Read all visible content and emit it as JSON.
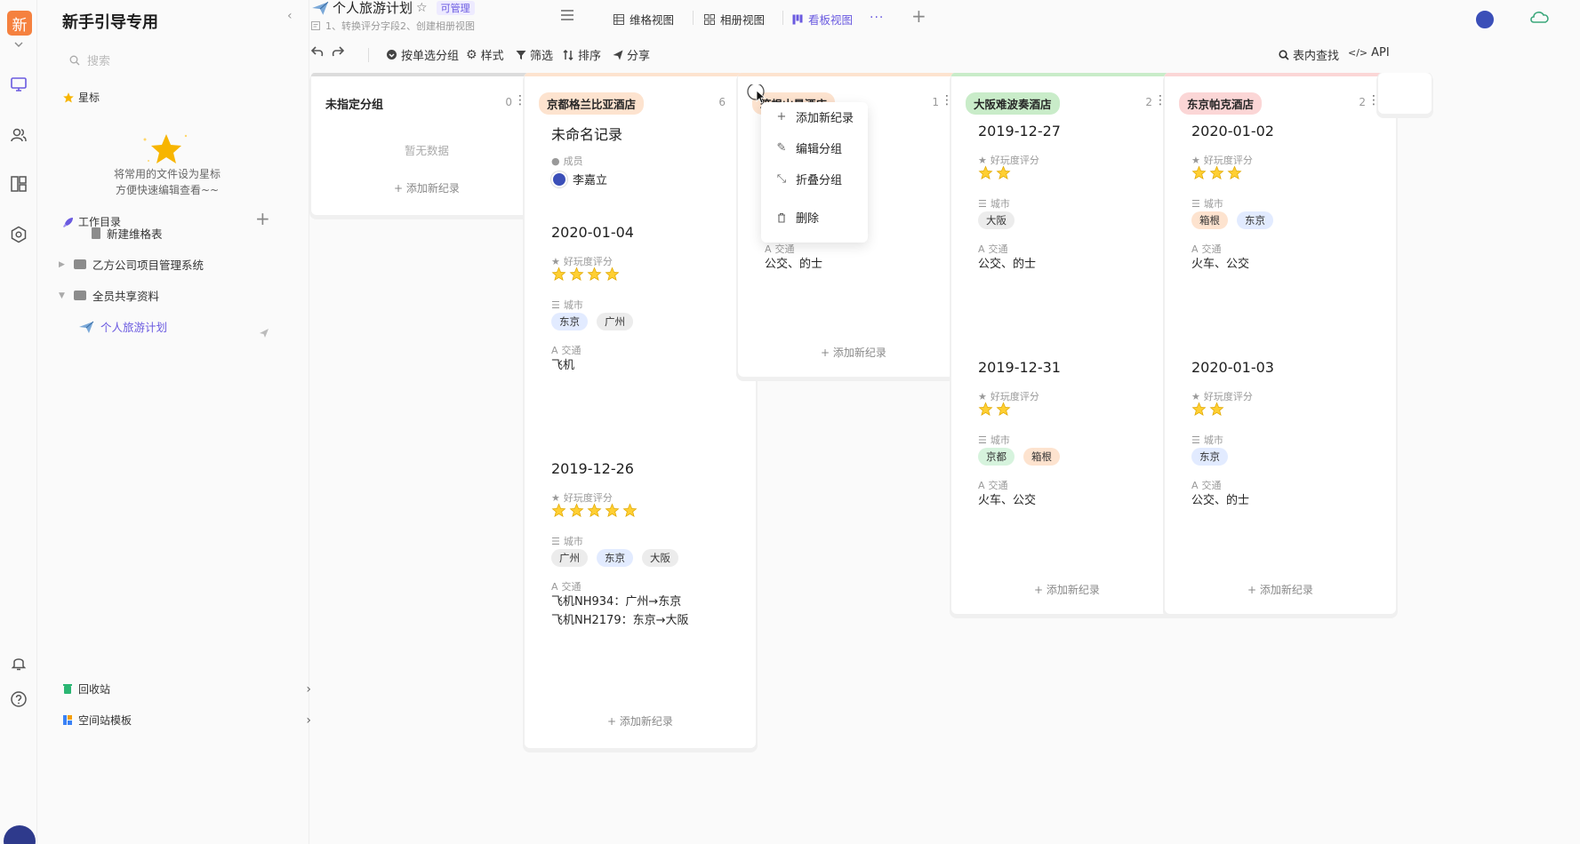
{
  "rail": {
    "space_badge": "新",
    "icons": [
      "monitor-icon",
      "users-icon",
      "layout-icon",
      "hexagon-icon",
      "bell-icon",
      "help-icon"
    ]
  },
  "sidebar": {
    "title": "新手引导专用",
    "search_placeholder": "搜索",
    "star_label": "星标",
    "star_hint_line1": "将常用的文件设为星标",
    "star_hint_line2": "方便快速编辑查看~~",
    "workdir_label": "工作目录",
    "tree": [
      {
        "label": "新建维格表",
        "type": "doc"
      },
      {
        "label": "乙方公司项目管理系统",
        "type": "folder"
      },
      {
        "label": "全员共享资料",
        "type": "folder"
      },
      {
        "label": "个人旅游计划",
        "type": "sheet"
      }
    ],
    "recycle_label": "回收站",
    "template_label": "空间站模板"
  },
  "header": {
    "title": "个人旅游计划",
    "badge": "可管理",
    "description": "1、转换评分字段2、创建相册视图",
    "views": {
      "grid": "维格视图",
      "gallery": "相册视图",
      "kanban": "看板视图"
    }
  },
  "toolbar": {
    "group": "按单选分组",
    "style": "样式",
    "filter": "筛选",
    "sort": "排序",
    "share": "分享",
    "find": "表内查找",
    "api": "API"
  },
  "accent": "#6a5ae0",
  "board": {
    "add_record": "添加新纪录",
    "empty": "暂无数据",
    "field_member": "成员",
    "field_rating": "好玩度评分",
    "field_city": "城市",
    "field_transport": "交通",
    "columns": [
      {
        "name": "未指定分组",
        "count": "0",
        "color": "#dcdcdc"
      },
      {
        "name": "京都格兰比亚酒店",
        "count": "6",
        "color": "#fde3cf"
      },
      {
        "name": "箱根山景酒店",
        "count": "1",
        "color": "#fde3cf"
      },
      {
        "name": "大阪难波奏酒店",
        "count": "2",
        "color": "#c9ecc9"
      },
      {
        "name": "东京帕克酒店",
        "count": "2",
        "color": "#fbd6d6"
      }
    ],
    "kyoto_cards": [
      {
        "title": "未命名记录",
        "member": "李嘉立"
      },
      {
        "title": "2020-01-04",
        "rating": 4,
        "cities": [
          "东京",
          "广州"
        ],
        "transport": "飞机"
      },
      {
        "title": "2019-12-26",
        "rating": 5,
        "cities": [
          "广州",
          "东京",
          "大阪"
        ],
        "transport_line1": "飞机NH934：广州→东京",
        "transport_line2": "飞机NH2179：东京→大阪"
      }
    ],
    "hakone_cards": [
      {
        "transport": "公交、的士"
      }
    ],
    "osaka_cards": [
      {
        "title": "2019-12-27",
        "rating": 2,
        "cities": [
          "大阪"
        ],
        "transport": "公交、的士"
      },
      {
        "title": "2019-12-31",
        "rating": 2,
        "cities": [
          "京都",
          "箱根"
        ],
        "transport": "火车、公交"
      }
    ],
    "tokyo_cards": [
      {
        "title": "2020-01-02",
        "rating": 3,
        "cities": [
          "箱根",
          "东京"
        ],
        "transport": "火车、公交"
      },
      {
        "title": "2020-01-03",
        "rating": 2,
        "cities": [
          "东京"
        ],
        "transport": "公交、的士"
      }
    ]
  },
  "context_menu": {
    "add": "添加新纪录",
    "edit": "编辑分组",
    "collapse": "折叠分组",
    "delete": "删除"
  }
}
